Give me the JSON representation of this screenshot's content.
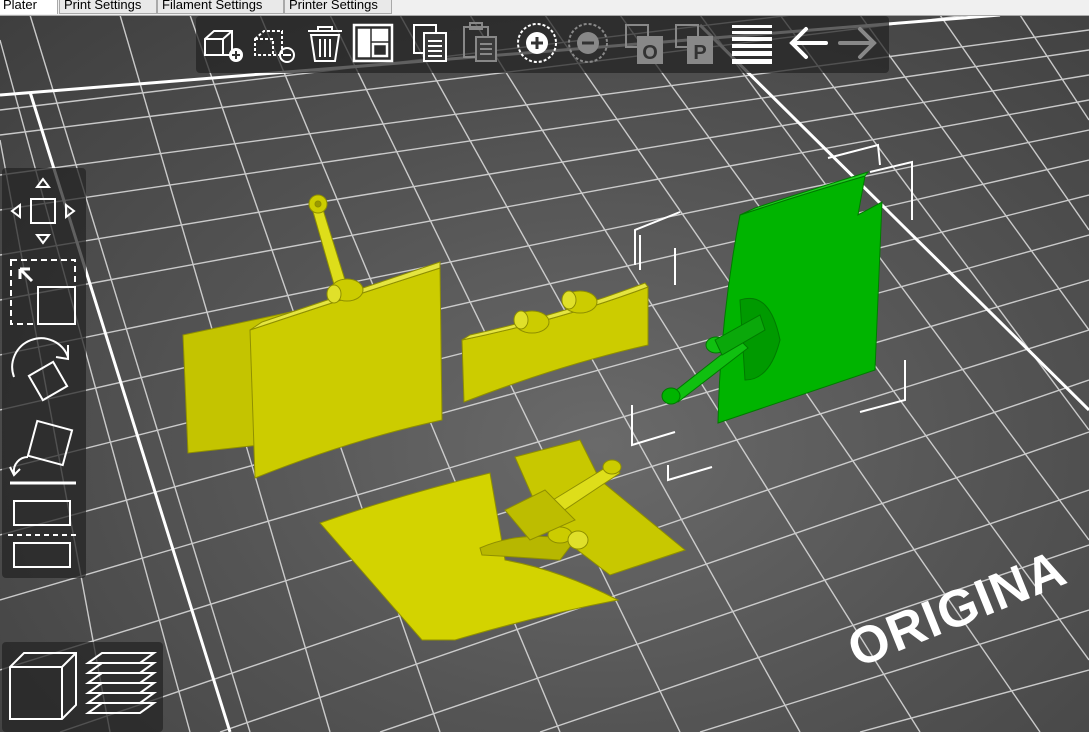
{
  "tabs": [
    {
      "label": "Plater"
    },
    {
      "label": "Print Settings"
    },
    {
      "label": "Filament Settings"
    },
    {
      "label": "Printer Settings"
    }
  ],
  "toolbar": {
    "items": [
      {
        "name": "add-icon"
      },
      {
        "name": "delete-icon"
      },
      {
        "name": "delete-all-icon"
      },
      {
        "name": "arrange-icon"
      },
      {
        "name": "copy-icon"
      },
      {
        "name": "paste-icon"
      },
      {
        "name": "add-instance-icon"
      },
      {
        "name": "remove-instance-icon"
      },
      {
        "name": "split-objects-icon"
      },
      {
        "name": "split-parts-icon"
      },
      {
        "name": "layers-editing-icon"
      },
      {
        "name": "undo-icon"
      },
      {
        "name": "redo-icon"
      }
    ],
    "split_objects_letter": "O",
    "split_parts_letter": "P"
  },
  "sidebar": {
    "items": [
      {
        "name": "move-tool-icon"
      },
      {
        "name": "scale-tool-icon"
      },
      {
        "name": "rotate-tool-icon"
      },
      {
        "name": "place-on-face-icon"
      },
      {
        "name": "cut-tool-icon"
      }
    ]
  },
  "view_switch": {
    "items": [
      {
        "name": "3d-view-icon"
      },
      {
        "name": "preview-view-icon"
      }
    ]
  },
  "bed_brand": "ORIGINA",
  "colors": {
    "model_yellow": "#cccc00",
    "model_selected": "#00b800",
    "bed_grid": "#ffffff",
    "toolbar_bg": "#232323"
  }
}
